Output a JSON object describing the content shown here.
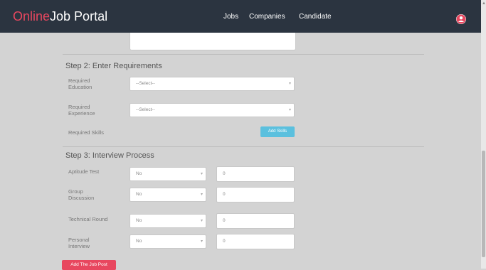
{
  "navbar": {
    "brand_accent": "Online",
    "brand_rest": "Job Portal",
    "links": [
      "Jobs",
      "Companies",
      "Candidate"
    ],
    "background": "#2b3440",
    "accent_color": "#e8475f",
    "avatar_icon": "user-icon"
  },
  "step2": {
    "title": "Step 2: Enter Requirements",
    "education_label": "Required Education",
    "education_value": "--Select--",
    "experience_label": "Required Experience",
    "experience_value": "--Select--",
    "skills_label": "Required Skills",
    "add_skills_button": "Add Skills"
  },
  "step3": {
    "title": "Step 3: Interview Process",
    "rounds": [
      {
        "label": "Aptitude Test",
        "select": "No",
        "value": "0"
      },
      {
        "label": "Group Discussion",
        "select": "No",
        "value": "0"
      },
      {
        "label": "Technical Round",
        "select": "No",
        "value": "0"
      },
      {
        "label": "Personal Interview",
        "select": "No",
        "value": "0"
      }
    ]
  },
  "submit_button": "Add The Job Post",
  "colors": {
    "page_bg": "#d3d3d3",
    "info_button": "#5bc0de",
    "danger_button": "#e8475f"
  }
}
